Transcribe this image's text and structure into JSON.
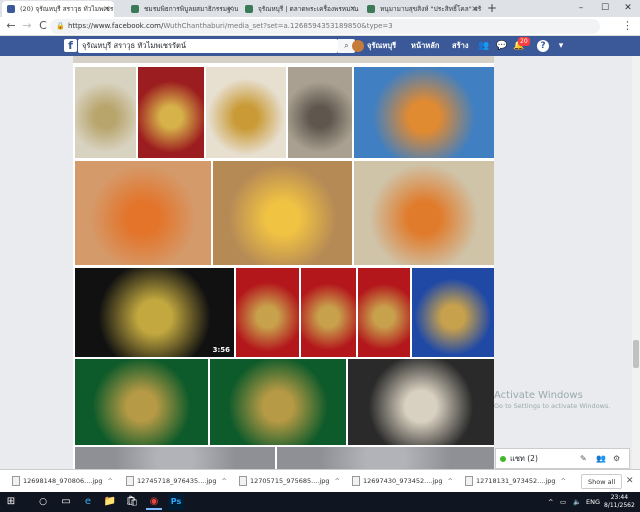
{
  "browser": {
    "tabs": [
      {
        "label": "(20) จุรัณหบุรี สราวุธ ทัวไมพเชรรัตน์",
        "fav_color": "#3b5998",
        "active": true
      },
      {
        "label": "ชมรมพิธการพิบูลยสมาธิกรรมฐานสัง | VIT",
        "fav_color": "#3b7a57",
        "active": false
      },
      {
        "label": "จุรัณหบุรี | ตลาดพระเครื่องพรหมาน",
        "fav_color": "#3b7a57",
        "active": false
      },
      {
        "label": "หนุมามาบสุขสิงห์ \"ประสิทธิ์โคล\" สร้าง",
        "fav_color": "#3b7a57",
        "active": false
      }
    ],
    "new_tab": "+",
    "window_buttons": [
      "–",
      "☐",
      "✕"
    ],
    "nav": {
      "back": "←",
      "forward": "→",
      "reload": "C"
    },
    "url_domain": "https://www.facebook.com/",
    "url_path": "WuthChanthaburi/media_set?set=a.1268594353189850&type=3",
    "star": "☆",
    "menu": "⋮"
  },
  "facebook": {
    "logo": "f",
    "search_value": "จุรัณหบุรี สราวุธ ทัวไมพเชรรัตน์",
    "search_icon": "⌕",
    "profile_name": "จุรัณหบุรี",
    "home_label": "หน้าหลัก",
    "create_label": "สร้าง",
    "notification_count": "20",
    "icons": {
      "friends": "👥",
      "messages": "💬",
      "notifications": "🔔",
      "help": "?",
      "dropdown": "▾"
    }
  },
  "gallery": {
    "photos": [
      {
        "color": "#d8d2c0",
        "accent": "#b8a56c"
      },
      {
        "color": "#9c1d1f",
        "accent": "#d7b24a"
      },
      {
        "color": "#e7dfd0",
        "accent": "#c99a35"
      },
      {
        "color": "#a9a091",
        "accent": "#5f574d"
      },
      {
        "color": "#3f7fc2",
        "accent": "#e08a32"
      },
      {
        "color": "#d59a6a",
        "accent": "#e3742a"
      },
      {
        "color": "#b68a55",
        "accent": "#f1c343"
      },
      {
        "color": "#cfc3a8",
        "accent": "#e07b2b"
      },
      {
        "color": "#111111",
        "accent": "#c2a83f"
      },
      {
        "color": "#b3161b",
        "accent": "#c8a14c"
      },
      {
        "color": "#b3161b",
        "accent": "#c8a14c"
      },
      {
        "color": "#b3161b",
        "accent": "#c8a14c"
      },
      {
        "color": "#2049a6",
        "accent": "#c8a14c"
      },
      {
        "color": "#0d5a2a",
        "accent": "#b79a45"
      },
      {
        "color": "#0d5a2a",
        "accent": "#b79a45"
      },
      {
        "color": "#2a2a2a",
        "accent": "#d8d0c0"
      },
      {
        "color": "#8e9096",
        "accent": "#b1b3b8"
      },
      {
        "color": "#8e9096",
        "accent": "#b1b3b8"
      }
    ],
    "video_duration": "3:56"
  },
  "overlay": {
    "watermark_title": "Activate Windows",
    "watermark_sub": "Go to Settings to activate Windows.",
    "chat_label": "แชท (2)",
    "chat_icons": [
      "✎",
      "👥",
      "⚙"
    ]
  },
  "downloads": {
    "items": [
      "12698148_970806....jpg",
      "12745718_976435....jpg",
      "12705715_975685....jpg",
      "12697430_973452....jpg",
      "12718131_973452....jpg"
    ],
    "show_all": "Show all",
    "close": "✕"
  },
  "taskbar": {
    "start": "⊞",
    "search": "○",
    "apps": [
      "▭",
      "e",
      "📁",
      "🛍",
      "◉",
      "Ps"
    ],
    "tray_chevron": "^",
    "tray_lang": "ENG",
    "time": "23:44",
    "date": "8/11/2562"
  }
}
